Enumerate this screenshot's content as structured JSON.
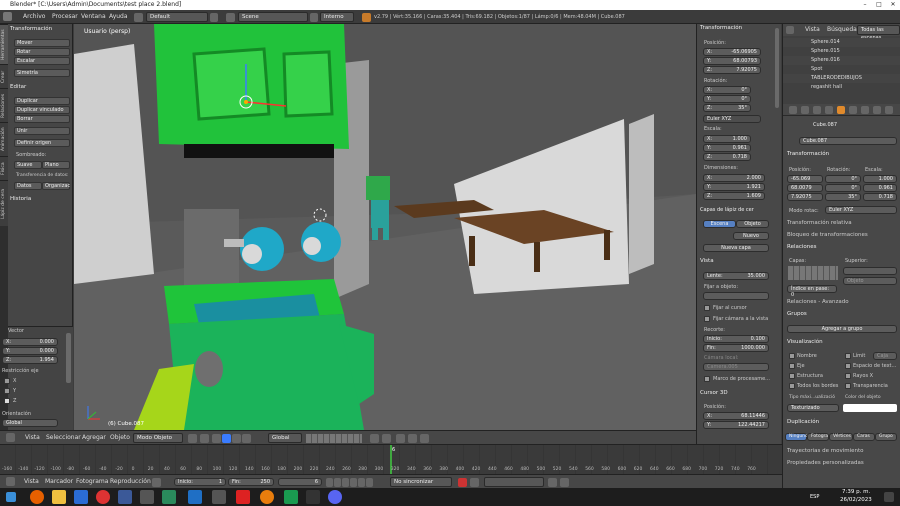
{
  "window": {
    "title": "Blender* [C:\\Users\\Admin\\Documents\\test place 2.blend]"
  },
  "info_header": {
    "menus": [
      "Archivo",
      "Procesar",
      "Ventana",
      "Ayuda"
    ],
    "screen_layout": "Default",
    "scene": "Scene",
    "engine": "Interno",
    "stats": "v2.79 | Vért:35.166 | Caras:35.404 | Tris:69.182 | Objetos:1/87 | Lámp:0/6 | Mem:48.04M | Cube.087"
  },
  "left_tabs": [
    "Herramientas",
    "Crear",
    "Relaciones",
    "Animación",
    "Física",
    "Lápiz de cera"
  ],
  "tool_shelf": {
    "transform_header": "Transformación",
    "transform_buttons": [
      "Mover",
      "Rotar",
      "Escalar"
    ],
    "symmetry": "Simetría",
    "edit_header": "Editar",
    "edit_buttons": [
      "Duplicar",
      "Duplicar vinculado",
      "Borrar",
      "Unir"
    ],
    "origin": "Definir origen",
    "shading_label": "Sombreado:",
    "shading_smooth": "Suave",
    "shading_flat": "Plano",
    "transfer_label": "Transferencia de datos:",
    "transfer_data": "Datos",
    "transfer_organize": "Organizac",
    "history": "Historia"
  },
  "operator_panel": {
    "vector_label": "Vector",
    "x": "0.000",
    "y": "0.000",
    "z": "1.954",
    "constraint_label": "Restricción eje",
    "axes": [
      "X",
      "Y",
      "Z"
    ],
    "orientation_label": "Orientación",
    "orientation_value": "Global"
  },
  "viewport": {
    "label": "Usuario (persp)",
    "object_label": "(6) Cube.087"
  },
  "viewport_header": {
    "menus": [
      "Vista",
      "Seleccionar",
      "Agregar",
      "Objeto"
    ],
    "mode": "Modo Objeto",
    "orientation": "Global"
  },
  "n_panel": {
    "transform_header": "Transformación",
    "location_label": "Posición:",
    "location": {
      "x": "-65.06905",
      "y": "68.00793",
      "z": "7.92075"
    },
    "rotation_label": "Rotación:",
    "rotation": {
      "x": "0°",
      "y": "0°",
      "z": "35°"
    },
    "euler": "Euler XYZ",
    "scale_label": "Escala:",
    "scale": {
      "x": "1.000",
      "y": "0.961",
      "z": "0.718"
    },
    "dimensions_label": "Dimensiones:",
    "dimensions": {
      "x": "2.000",
      "y": "1.921",
      "z": "1.609"
    },
    "gp_header": "Capas de lápiz de cer",
    "gp_tab_scene": "Escena",
    "gp_tab_object": "Objeto",
    "gp_new": "Nuevo",
    "gp_new_layer": "Nueva capa",
    "view_header": "Vista",
    "lens_label": "Lente:",
    "lens": "35.000",
    "lock_label": "Fijar a objeto:",
    "lock_cursor": "Fijar al cursor",
    "lock_camera": "Fijar cámara a la vista",
    "clip_label": "Recorte:",
    "clip_start_label": "Inicio:",
    "clip_start": "0.100",
    "clip_end_label": "Fin:",
    "clip_end": "1000.000",
    "local_camera_label": "Cámara local:",
    "local_camera": "Camera.005",
    "render_border": "Marco de procesame...",
    "cursor_header": "Cursor 3D",
    "cursor_location_label": "Posición:",
    "cursor_x": "68.11446",
    "cursor_y": "122.44217"
  },
  "outliner": {
    "header": [
      "Vista",
      "Búsqueda",
      "Todas las escenas"
    ],
    "items": [
      "Sphere.014",
      "Sphere.015",
      "Sphere.016",
      "Spot",
      "TABLERODEDIBUJOS",
      "regashit hall"
    ]
  },
  "properties": {
    "object_name": "Cube.087",
    "object_field": "Cube.087",
    "transform_header": "Transformación",
    "location_label": "Posición:",
    "rotation_label": "Rotación:",
    "scale_label": "Escala:",
    "loc": [
      "-65.069",
      "68.0079",
      "7.92075"
    ],
    "rot": [
      "0°",
      "0°",
      "35°"
    ],
    "scl": [
      "1.000",
      "0.961",
      "0.718"
    ],
    "rot_mode_label": "Modo rotac:",
    "rot_mode": "Euler XYZ",
    "delta": "Transformación relativa",
    "locks": "Bloqueo de transformaciones",
    "relations_header": "Relaciones",
    "layers_label": "Capas:",
    "parent_label": "Superior:",
    "parent_type": "Objeto",
    "pass_index": "Índice en pase: 0",
    "relations_extras": "Relaciones - Avanzado",
    "groups_header": "Grupos",
    "add_group": "Agregar a grupo",
    "display_header": "Visualización",
    "display_left": [
      "Nombre",
      "Eje",
      "Estructura",
      "Todos los bordes"
    ],
    "display_right": [
      "Límit",
      "Espacio de text...",
      "Rayos X",
      "Transparencia"
    ],
    "bounds_type": "Caja",
    "max_draw_label": "Tipo máxi...ualizació",
    "color_label": "Color del objeto",
    "max_draw_value": "Texturizado",
    "dup_header": "Duplicación",
    "dup_tabs": [
      "Ninguno",
      "Fotogra",
      "Vértices",
      "Caras",
      "Grupo"
    ],
    "motion_paths": "Trayectorias de movimiento",
    "custom_props": "Propiedades personalizadas"
  },
  "timeline": {
    "ticks": [
      "-160",
      "-140",
      "-120",
      "-100",
      "-80",
      "-60",
      "-40",
      "-20",
      "0",
      "20",
      "40",
      "60",
      "80",
      "100",
      "120",
      "140",
      "160",
      "180",
      "200",
      "220",
      "240",
      "260",
      "280",
      "300",
      "320",
      "340",
      "360",
      "380",
      "400",
      "420",
      "440",
      "460",
      "480",
      "500",
      "520",
      "540",
      "560",
      "580",
      "600",
      "620",
      "640",
      "660",
      "680",
      "700",
      "720",
      "740",
      "760"
    ],
    "current_frame_marker": "6"
  },
  "timeline_header": {
    "menus": [
      "Vista",
      "Marcador",
      "Fotograma",
      "Reproducción"
    ],
    "start_label": "Inicio:",
    "start": "1",
    "end_label": "Fin:",
    "end": "250",
    "current": "6",
    "sync": "No sincronizar"
  },
  "taskbar": {
    "lang": "ESP",
    "time": "7:39 p. m.",
    "date": "26/02/2023"
  }
}
